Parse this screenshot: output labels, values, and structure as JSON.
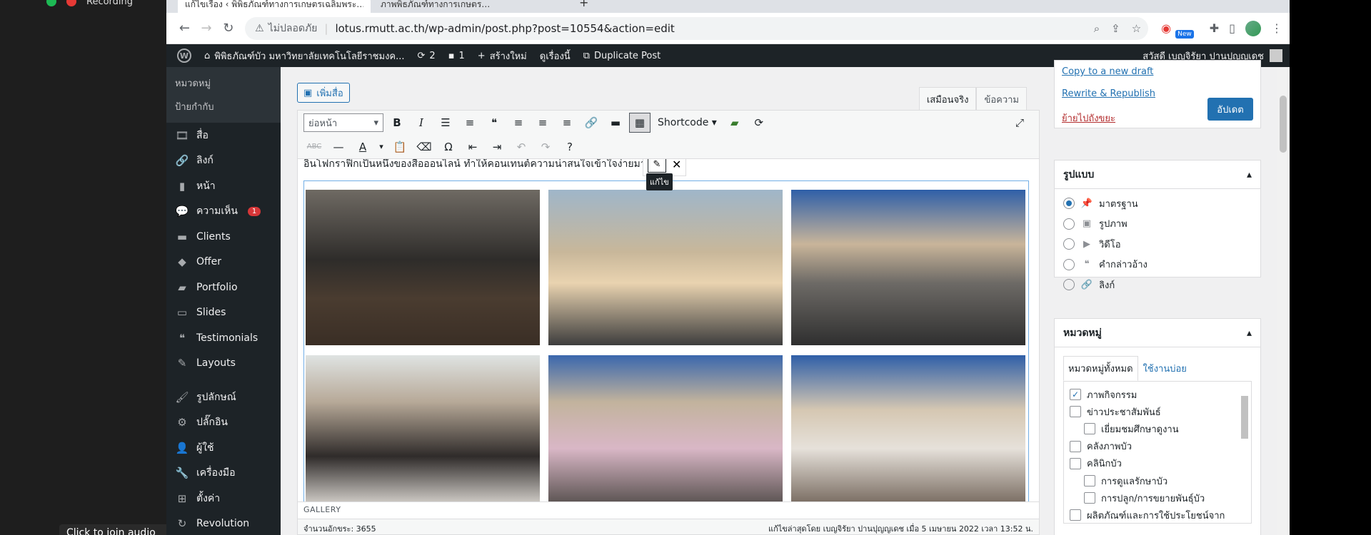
{
  "zoom": {
    "recording_label": "Recording",
    "join_audio": "Click to join audio"
  },
  "browser": {
    "tab_active_title": "แก้ไขเรื่อง ‹ พิพิธภัณฑ์ทางการเกษตรเฉลิมพระ…",
    "tab_other_title": "ภาพพิธภัณฑ์ทางการเกษตร…",
    "insecure_label": "ไม่ปลอดภัย",
    "url": "lotus.rmutt.ac.th/wp-admin/post.php?post=10554&action=edit",
    "new_badge": "New"
  },
  "adminbar": {
    "site_name": "พิพิธภัณฑ์บัว มหาวิทยาลัยเทคโนโลยีราชมงค...",
    "updates_count": "2",
    "comments_count": "1",
    "new_label": "สร้างใหม่",
    "view_label": "ดูเรื่องนี้",
    "duplicate_label": "Duplicate Post",
    "greeting": "สวัสดี เบญจิรัยา ปานปุญญเดช"
  },
  "sidebar": {
    "sub_items": [
      "หมวดหมู่",
      "ป้ายกำกับ"
    ],
    "items": [
      {
        "label": "สื่อ",
        "icon": "media-icon",
        "glyph": "🎞"
      },
      {
        "label": "ลิงก์",
        "icon": "link-icon",
        "glyph": "🔗"
      },
      {
        "label": "หน้า",
        "icon": "page-icon",
        "glyph": "▮"
      },
      {
        "label": "ความเห็น",
        "icon": "comment-icon",
        "glyph": "💬",
        "badge": "1"
      },
      {
        "label": "Clients",
        "icon": "clients-icon",
        "glyph": "▬"
      },
      {
        "label": "Offer",
        "icon": "tag-icon",
        "glyph": "◆"
      },
      {
        "label": "Portfolio",
        "icon": "portfolio-icon",
        "glyph": "▰"
      },
      {
        "label": "Slides",
        "icon": "slides-icon",
        "glyph": "▭"
      },
      {
        "label": "Testimonials",
        "icon": "quote-icon",
        "glyph": "❝"
      },
      {
        "label": "Layouts",
        "icon": "layouts-icon",
        "glyph": "✎"
      },
      {
        "label": "รูปลักษณ์",
        "icon": "appearance-icon",
        "glyph": "🖌"
      },
      {
        "label": "ปลั๊กอิน",
        "icon": "plugin-icon",
        "glyph": "⚙"
      },
      {
        "label": "ผู้ใช้",
        "icon": "users-icon",
        "glyph": "👤"
      },
      {
        "label": "เครื่องมือ",
        "icon": "tools-icon",
        "glyph": "🔧"
      },
      {
        "label": "ตั้งค่า",
        "icon": "settings-icon",
        "glyph": "⊞"
      },
      {
        "label": "Revolution",
        "icon": "revolution-icon",
        "glyph": "↻"
      }
    ]
  },
  "editor": {
    "add_media_label": "เพิ่มสื่อ",
    "tab_visual": "เสมือนจริง",
    "tab_text": "ข้อความ",
    "format_select": "ย่อหน้า",
    "shortcode_label": "Shortcode ▾",
    "intro_text": "อินโฟกราฟิกเป็นหนึ่งของสื่อออนไลน์ ทำให้คอนเทนต์ความน่าสนใจเข้าใจง่ายมากขึ้น",
    "edit_tooltip": "แก้ไข",
    "gallery_label": "GALLERY",
    "word_count": "จำนวนอักขระ: 3655",
    "last_edited": "แก้ไขล่าสุดโดย เบญจิรัยา ปานปุญญเดช เมื่อ 5 เมษายน 2022 เวลา 13:52 น."
  },
  "publish": {
    "copy_draft": "Copy to a new draft",
    "rewrite": "Rewrite & Republish",
    "trash": "ย้ายไปถังขยะ",
    "update": "อัปเดต"
  },
  "format_panel": {
    "title": "รูปแบบ",
    "options": [
      {
        "label": "มาตรฐาน",
        "checked": true,
        "glyph": "📌"
      },
      {
        "label": "รูปภาพ",
        "checked": false,
        "glyph": "▣"
      },
      {
        "label": "วิดีโอ",
        "checked": false,
        "glyph": "▶"
      },
      {
        "label": "คำกล่าวอ้าง",
        "checked": false,
        "glyph": "❝"
      },
      {
        "label": "ลิงก์",
        "checked": false,
        "glyph": "🔗"
      }
    ]
  },
  "category_panel": {
    "title": "หมวดหมู่",
    "tab_all": "หมวดหมู่ทั้งหมด",
    "tab_popular": "ใช้งานบ่อย",
    "items": [
      {
        "label": "ภาพกิจกรรม",
        "checked": true,
        "child": false
      },
      {
        "label": "ข่าวประชาสัมพันธ์",
        "checked": false,
        "child": false
      },
      {
        "label": "เยี่ยมชมศึกษาดูงาน",
        "checked": false,
        "child": true
      },
      {
        "label": "คลังภาพบัว",
        "checked": false,
        "child": false
      },
      {
        "label": "คลินิกบัว",
        "checked": false,
        "child": false
      },
      {
        "label": "การดูแลรักษาบัว",
        "checked": false,
        "child": true
      },
      {
        "label": "การปลูก/การขยายพันธุ์บัว",
        "checked": false,
        "child": true
      },
      {
        "label": "ผลิตภัณฑ์และการใช้ประโยชน์จาก",
        "checked": false,
        "child": false
      }
    ]
  },
  "colors": {
    "wp_dark": "#1d2327",
    "wp_blue": "#2271b1",
    "trash_red": "#b32d2e"
  }
}
